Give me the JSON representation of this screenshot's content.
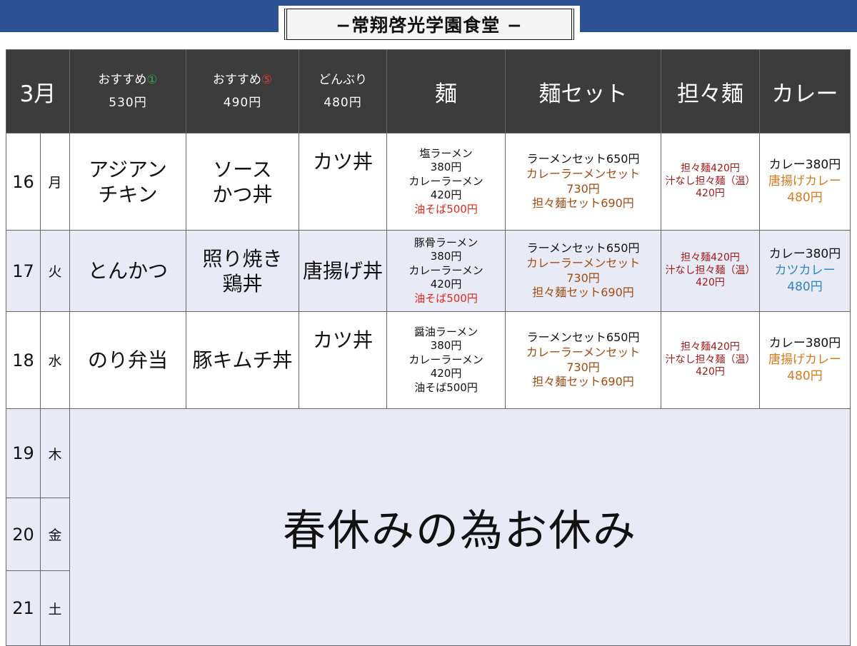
{
  "header": {
    "title": "−常翔啓光学園食堂 −"
  },
  "table": {
    "month": "3月",
    "columns": {
      "rec1_label": "おすすめ",
      "rec1_mark": "①",
      "rec1_price": "530円",
      "rec5_label": "おすすめ",
      "rec5_mark": "⑤",
      "rec5_price": "490円",
      "don_label": "どんぶり",
      "don_price": "480円",
      "men": "麺",
      "men_set": "麺セット",
      "tantan": "担々麺",
      "curry": "カレー"
    },
    "rows": [
      {
        "day": "16",
        "dow": "月",
        "rec1": [
          "アジアン",
          "チキン"
        ],
        "rec5": [
          "ソース",
          "かつ丼"
        ],
        "don": "カツ丼",
        "men": [
          "塩ラーメン",
          "380円",
          "カレーラーメン",
          "420円",
          "油そば500円"
        ],
        "set": [
          "ラーメンセット650円",
          "カレーラーメンセット",
          "730円",
          "担々麺セット690円"
        ],
        "tan": [
          "担々麺420円",
          "汁なし担々麺（温）",
          "420円"
        ],
        "curry": [
          "カレー380円",
          "唐揚げカレー",
          "480円"
        ]
      },
      {
        "day": "17",
        "dow": "火",
        "rec1": [
          "とんかつ"
        ],
        "rec5": [
          "照り焼き",
          "鶏丼"
        ],
        "don": "唐揚げ丼",
        "men": [
          "豚骨ラーメン",
          "380円",
          "カレーラーメン",
          "420円",
          "油そば500円"
        ],
        "set": [
          "ラーメンセット650円",
          "カレーラーメンセット",
          "730円",
          "担々麺セット690円"
        ],
        "tan": [
          "担々麺420円",
          "汁なし担々麺（温）",
          "420円"
        ],
        "curry": [
          "カレー380円",
          "カツカレー",
          "480円"
        ]
      },
      {
        "day": "18",
        "dow": "水",
        "rec1": [
          "のり弁当"
        ],
        "rec5": [
          "豚キムチ丼"
        ],
        "don": "カツ丼",
        "men": [
          "醤油ラーメン",
          "380円",
          "カレーラーメン",
          "420円",
          "油そば500円"
        ],
        "set": [
          "ラーメンセット650円",
          "カレーラーメンセット",
          "730円",
          "担々麺セット690円"
        ],
        "tan": [
          "担々麺420円",
          "汁なし担々麺（温）",
          "420円"
        ],
        "curry": [
          "カレー380円",
          "唐揚げカレー",
          "480円"
        ]
      }
    ],
    "closed_days": [
      {
        "day": "19",
        "dow": "木"
      },
      {
        "day": "20",
        "dow": "金"
      },
      {
        "day": "21",
        "dow": "土"
      }
    ],
    "closed_message": "春休みの為お休み"
  },
  "colors": {
    "topbar": "#2d5294",
    "header_bg": "#3c3c3c",
    "row_alt": "#e8ebf5"
  }
}
